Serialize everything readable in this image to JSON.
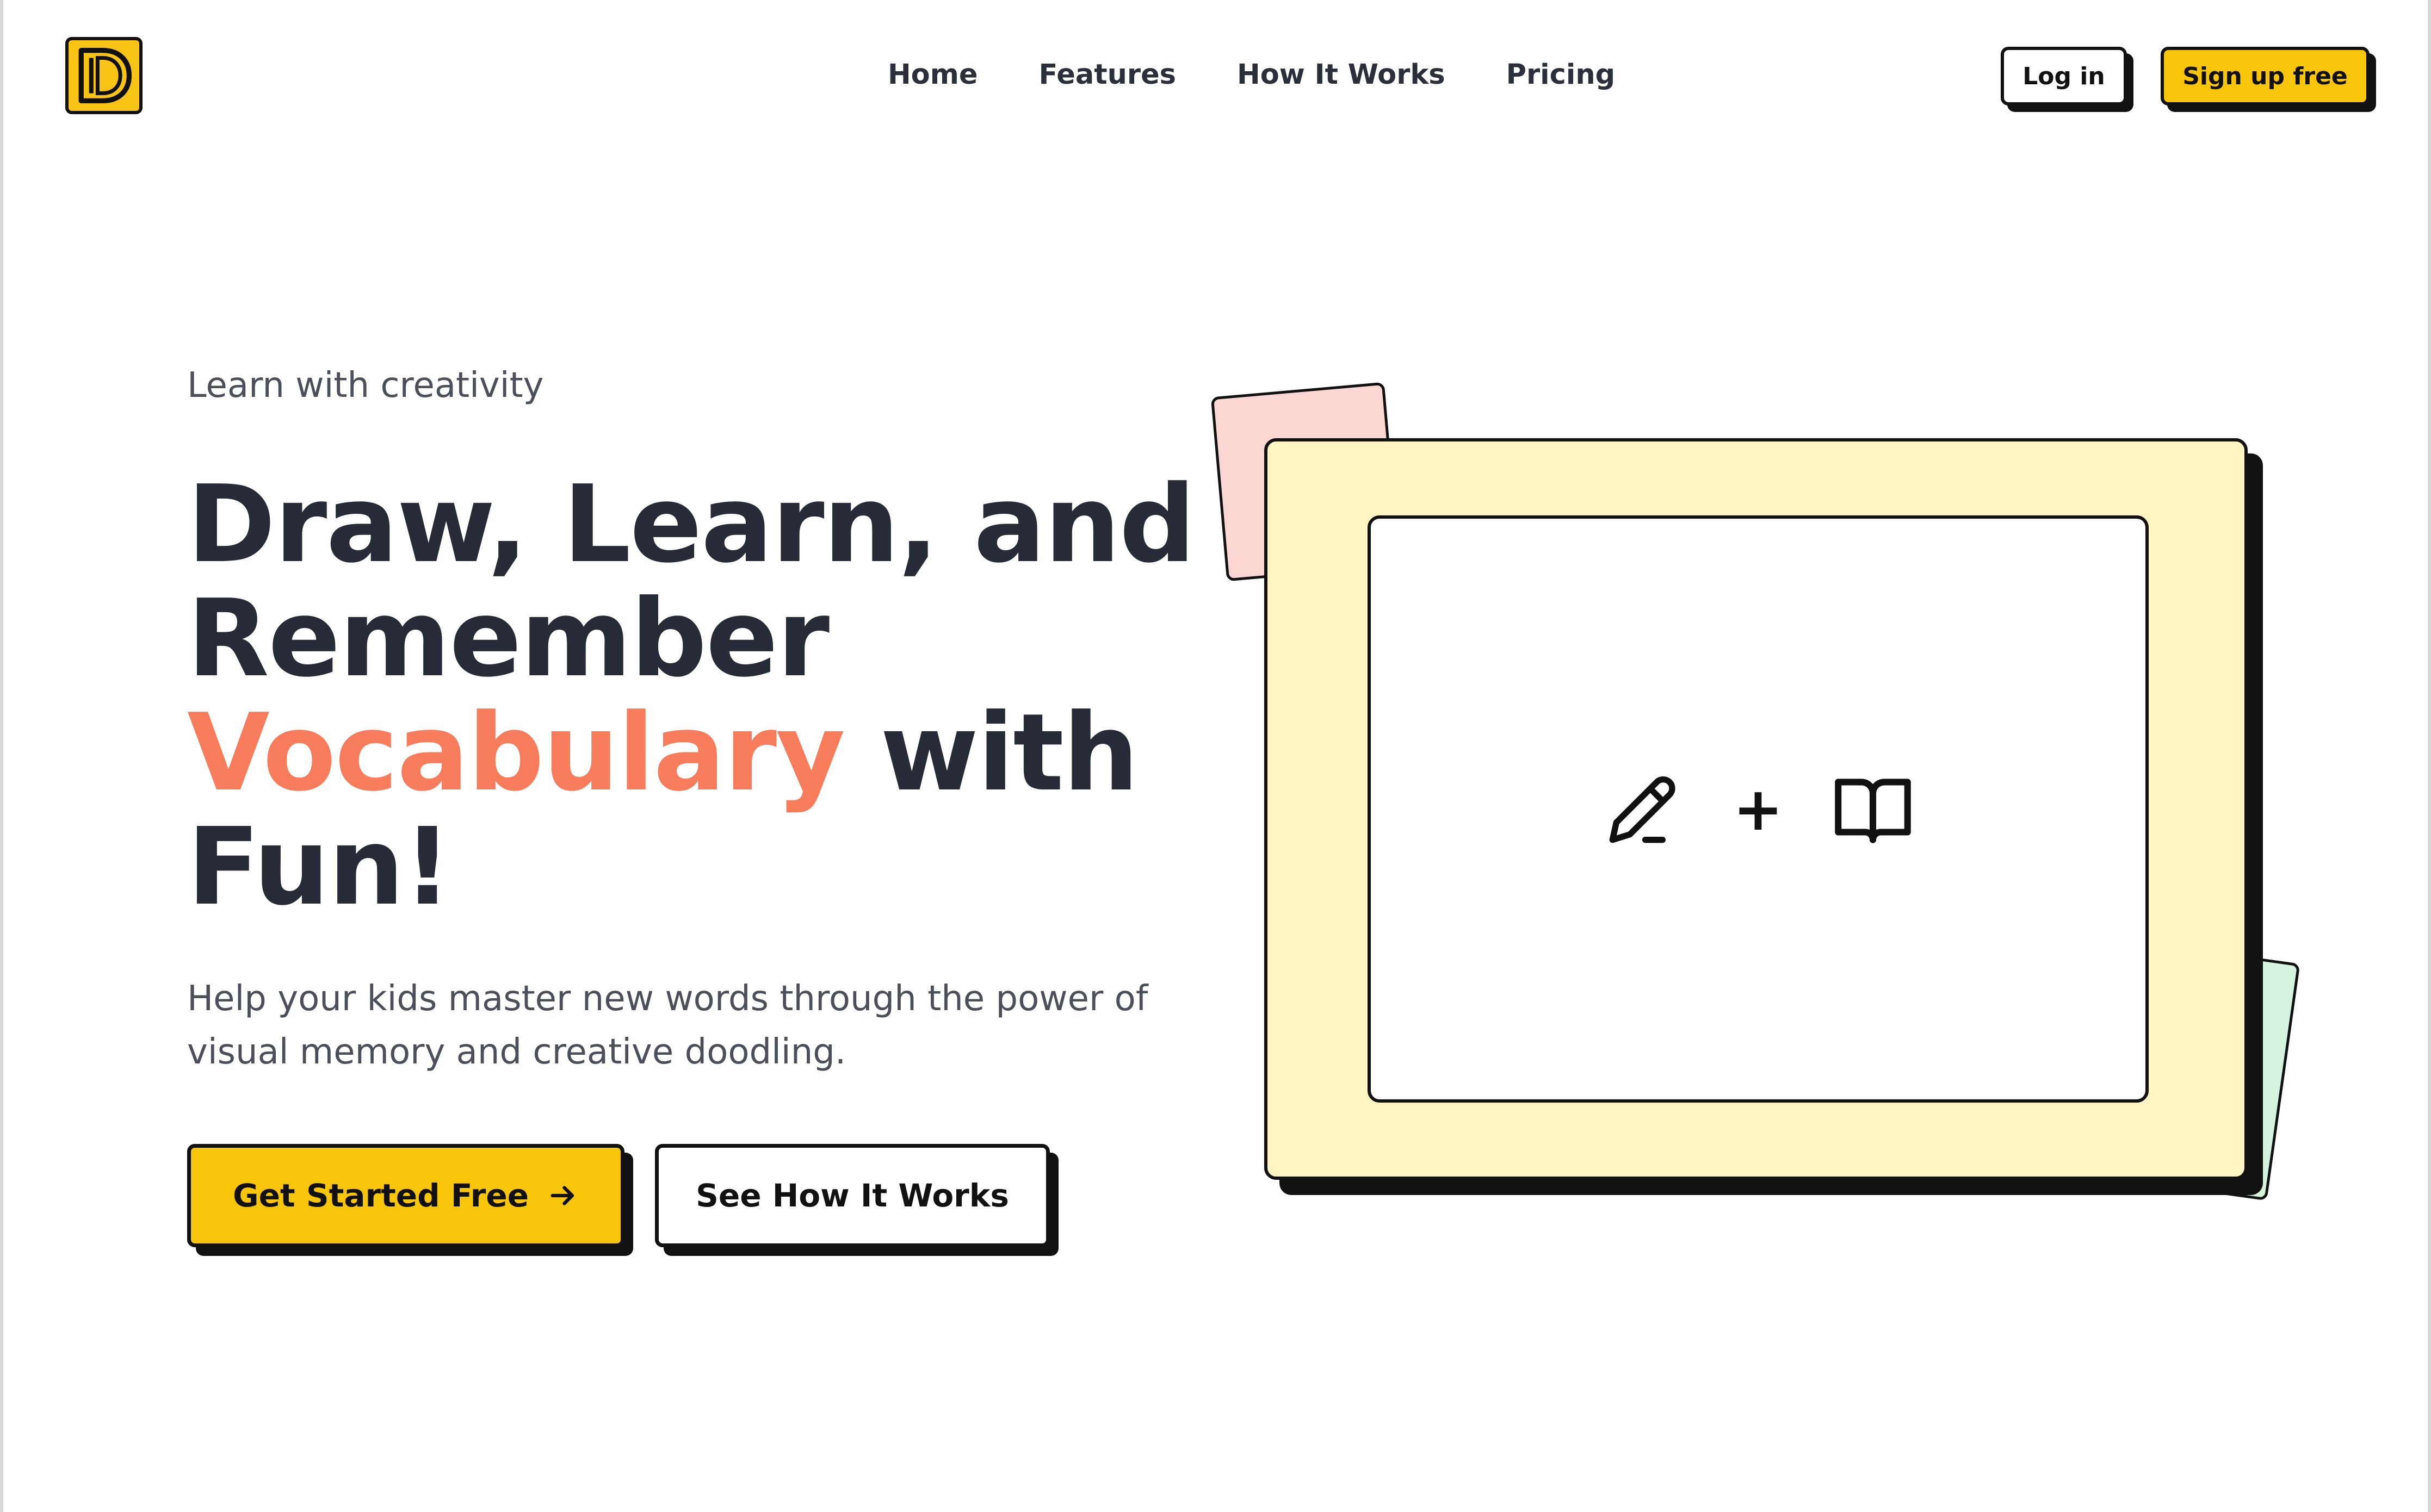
{
  "brand": {
    "logo_letter": "D",
    "accent_color": "#f7c50a"
  },
  "nav": {
    "items": [
      {
        "label": "Home"
      },
      {
        "label": "Features"
      },
      {
        "label": "How It Works"
      },
      {
        "label": "Pricing"
      }
    ],
    "login_label": "Log in",
    "signup_label": "Sign up free"
  },
  "hero": {
    "eyebrow": "Learn with creativity",
    "headline_line1": "Draw, Learn, and",
    "headline_line2": "Remember",
    "headline_accent": "Vocabulary",
    "headline_after_accent": " with",
    "headline_line4": "Fun!",
    "subtext": "Help your kids master new words through the power of visual memory and creative doodling.",
    "primary_cta": "Get Started Free",
    "secondary_cta": "See How It Works",
    "accent_color": "#f77c5c"
  },
  "illustration": {
    "icons": [
      "pencil-icon",
      "plus-sign",
      "book-icon"
    ],
    "plus_text": "+",
    "colors": {
      "frame": "#fff4c2",
      "pink_card": "#fcd6d3",
      "green_card": "#d4f4df"
    }
  }
}
